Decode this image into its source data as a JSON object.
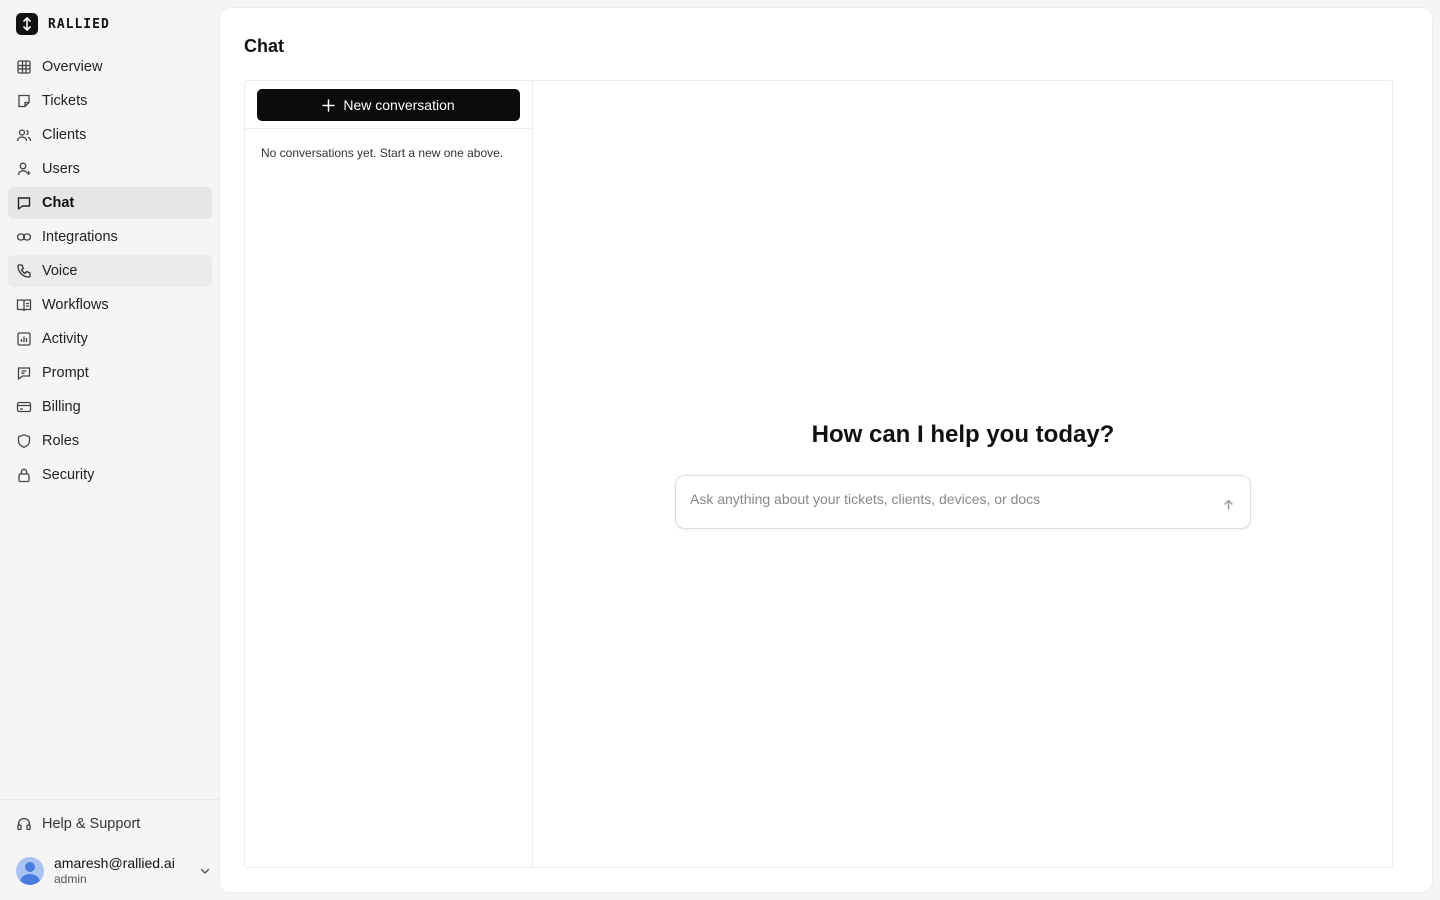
{
  "brand": {
    "name": "RALLIED"
  },
  "sidebar": {
    "items": [
      {
        "label": "Overview",
        "icon": "grid-icon"
      },
      {
        "label": "Tickets",
        "icon": "ticket-icon"
      },
      {
        "label": "Clients",
        "icon": "users-icon"
      },
      {
        "label": "Users",
        "icon": "user-icon"
      },
      {
        "label": "Chat",
        "icon": "chat-icon",
        "active": true
      },
      {
        "label": "Integrations",
        "icon": "link-icon"
      },
      {
        "label": "Voice",
        "icon": "phone-icon",
        "hover": true
      },
      {
        "label": "Workflows",
        "icon": "book-icon"
      },
      {
        "label": "Activity",
        "icon": "bar-chart-icon"
      },
      {
        "label": "Prompt",
        "icon": "message-text-icon"
      },
      {
        "label": "Billing",
        "icon": "credit-card-icon"
      },
      {
        "label": "Roles",
        "icon": "shield-icon"
      },
      {
        "label": "Security",
        "icon": "lock-icon"
      }
    ],
    "help_label": "Help & Support",
    "user": {
      "email": "amaresh@rallied.ai",
      "role": "admin"
    }
  },
  "main": {
    "title": "Chat",
    "new_conversation_label": "New conversation",
    "empty_text": "No conversations yet. Start a new one above.",
    "welcome": "How can I help you today?",
    "input_placeholder": "Ask anything about your tickets, clients, devices, or docs"
  },
  "colors": {
    "accent": "#0b0b0b",
    "active_bg": "#e6e6e6",
    "avatar": "#4a7de0"
  }
}
